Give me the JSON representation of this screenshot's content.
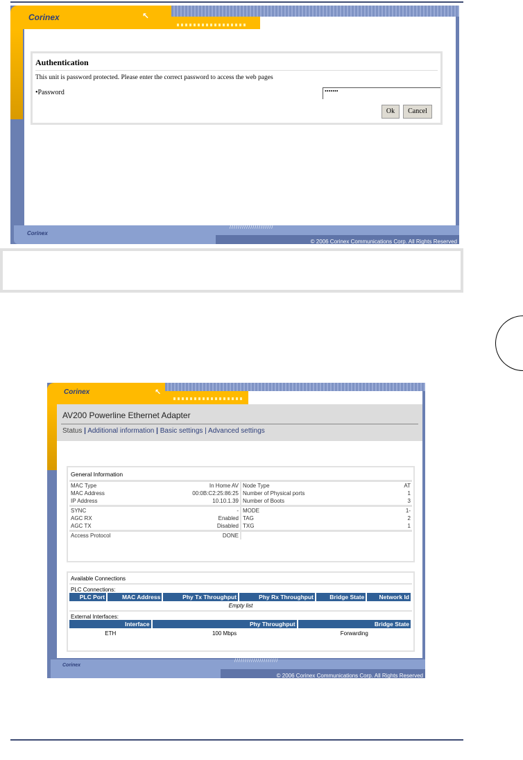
{
  "auth_screen": {
    "logo": "Corinex",
    "title": "Authentication",
    "message": "This unit is password protected. Please enter the correct password to access the web pages",
    "password_label": "•Password",
    "password_value": "•••••••",
    "ok_label": "Ok",
    "cancel_label": "Cancel",
    "footer_logo": "Corinex",
    "copyright": "© 2006 Corinex Communications Corp. All Rights Reserved"
  },
  "status_screen": {
    "logo": "Corinex",
    "title": "AV200 Powerline Ethernet Adapter",
    "nav": [
      {
        "label": "Status"
      },
      {
        "label": "Additional information"
      },
      {
        "label": "Basic settings"
      },
      {
        "label": "Advanced settings"
      }
    ],
    "general": {
      "heading": "General Information",
      "rows1": [
        [
          "MAC Type",
          "In Home AV",
          "Node Type",
          "AT"
        ],
        [
          "MAC Address",
          "00:0B:C2:25:86:25",
          "Number of Physical ports",
          "1"
        ],
        [
          "IP Address",
          "10.10.1.39",
          "Number of Boots",
          "3"
        ]
      ],
      "rows2": [
        [
          "SYNC",
          "-",
          "MODE",
          "1-"
        ],
        [
          "AGC RX",
          "Enabled",
          "TAG",
          "2"
        ],
        [
          "AGC TX",
          "Disabled",
          "TXG",
          "1"
        ]
      ],
      "rows3": [
        [
          "Access Protocol",
          "DONE"
        ]
      ]
    },
    "connections": {
      "heading": "Available Connections",
      "plc_label": "PLC Connections:",
      "plc_headers": [
        "PLC Port",
        "MAC Address",
        "Phy Tx Throughput",
        "Phy Rx Throughput",
        "Bridge State",
        "Network Id"
      ],
      "plc_empty": "Empty list",
      "ext_label": "External Interfaces:",
      "ext_headers": [
        "Interface",
        "Phy Throughput",
        "Bridge State"
      ],
      "ext_rows": [
        [
          "ETH",
          "100 Mbps",
          "Forwarding"
        ]
      ]
    },
    "footer_logo": "Corinex",
    "copyright": "© 2006 Corinex Communications Corp. All Rights Reserved"
  },
  "colors": {
    "orange": "#ffba00",
    "blue": "#6a7fb2",
    "header_blue": "#2f5f96"
  }
}
